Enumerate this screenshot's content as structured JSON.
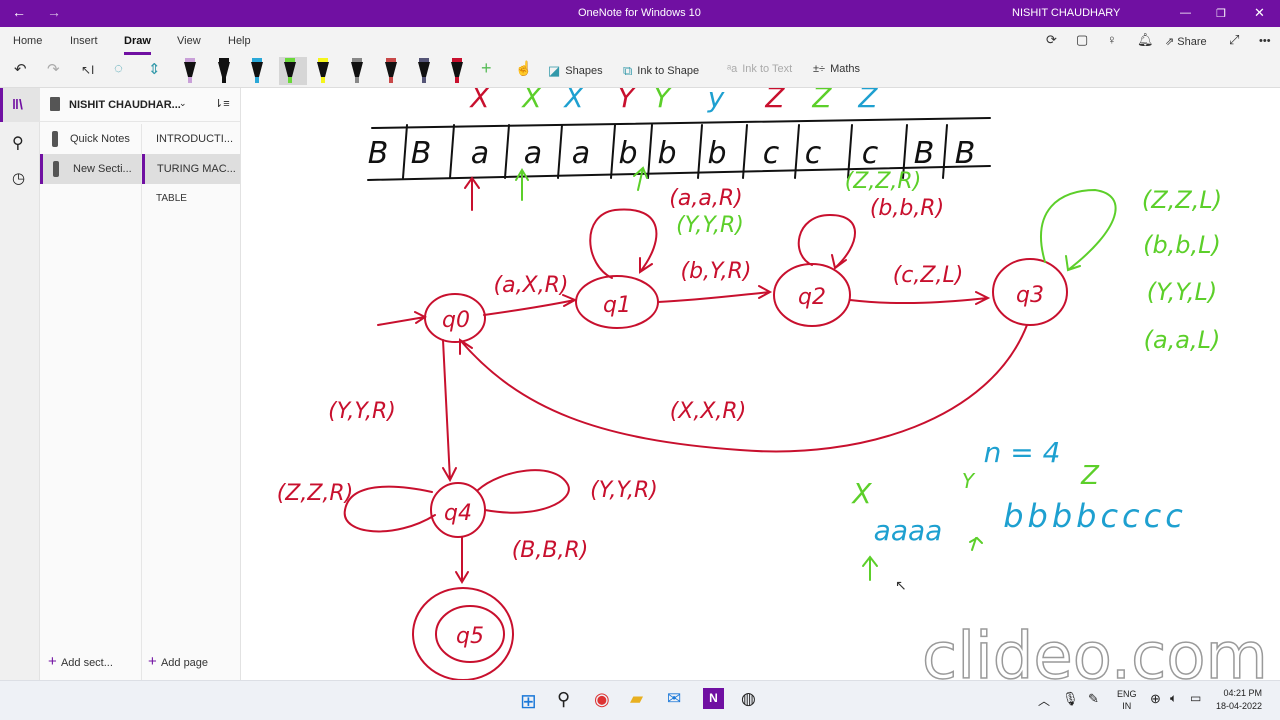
{
  "titlebar": {
    "title": "OneNote for Windows 10",
    "user": "NISHIT CHAUDHARY"
  },
  "tabs": [
    "Home",
    "Insert",
    "Draw",
    "View",
    "Help"
  ],
  "ribbon_right": {
    "share": "Share"
  },
  "toolbar": {
    "shapes": "Shapes",
    "ink_to_shape": "Ink to Shape",
    "ink_to_text": "Ink to Text",
    "maths": "Maths"
  },
  "pen_colors": [
    "#c9a0d8",
    "#111111",
    "#2aa8d8",
    "#6ad83a",
    "#f5f51a",
    "#888888",
    "#c84848",
    "#555577",
    "#c8102e"
  ],
  "notebook": {
    "name": "NISHIT CHAUDHAR...",
    "sections": [
      "Quick Notes",
      "New Secti..."
    ],
    "pages": [
      "INTRODUCTI...",
      "TURING MAC...",
      "TABLE"
    ],
    "add_section": "Add sect...",
    "add_page": "Add page"
  },
  "canvas": {
    "tape": [
      "B",
      "B",
      "a",
      "a",
      "a",
      "b",
      "b",
      "b",
      "c",
      "c",
      "c",
      "B",
      "B"
    ],
    "marks": [
      {
        "t": "X",
        "c": "red"
      },
      {
        "t": "X",
        "c": "green"
      },
      {
        "t": "X",
        "c": "blue"
      },
      {
        "t": "Y",
        "c": "red"
      },
      {
        "t": "Y",
        "c": "green"
      },
      {
        "t": "y",
        "c": "blue"
      },
      {
        "t": "Z",
        "c": "red"
      },
      {
        "t": "Z",
        "c": "green"
      },
      {
        "t": "Z",
        "c": "blue"
      }
    ],
    "states": [
      "q0",
      "q1",
      "q2",
      "q3",
      "q4",
      "q5"
    ],
    "labels": {
      "q0q1": "(a,X,R)",
      "q1loop_a": "(a,a,R)",
      "q1loop_y": "(Y,Y,R)",
      "q1q2": "(b,Y,R)",
      "q2loop_z": "(Z,Z,R)",
      "q2loop_b": "(b,b,R)",
      "q2q3": "(c,Z,L)",
      "q3loop": [
        "(Z,Z,L)",
        "(b,b,L)",
        "(Y,Y,L)",
        "(a,a,L)"
      ],
      "q3q0": "(X,X,R)",
      "q0q4": "(Y,Y,R)",
      "q4loop_z": "(Z,Z,R)",
      "q4loop_y": "(Y,Y,R)",
      "q4q5": "(B,B,R)"
    },
    "example": {
      "n": "n = 4",
      "x": "X",
      "y": "Y",
      "z": "Z",
      "a": "aaaa",
      "bc": "bbbbcccc"
    },
    "watermark": "clideo.com"
  },
  "colors": {
    "red": "#c8102e",
    "green": "#5ccf2a",
    "blue": "#1ea0d0",
    "accent": "#7010a2"
  },
  "taskbar": {
    "lang1": "ENG",
    "lang2": "IN",
    "time": "04:21 PM",
    "date": "18-04-2022"
  }
}
